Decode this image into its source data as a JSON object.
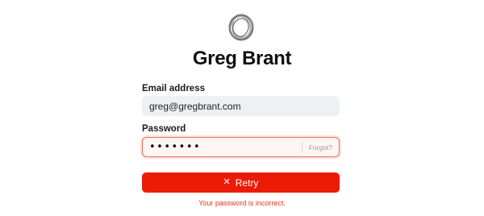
{
  "app": {
    "title": "Greg Brant",
    "logo_icon": "ring-logo-icon"
  },
  "email": {
    "label": "Email address",
    "value": "greg@gregbrant.com"
  },
  "password": {
    "label": "Password",
    "masked_value": "•••••••",
    "forgot_label": "Forgot?"
  },
  "actions": {
    "retry_label": "Retry",
    "retry_icon": "x-icon"
  },
  "error": {
    "message": "Your password is incorrect."
  },
  "colors": {
    "accent": "#ec1b05",
    "error_text": "#e2331d",
    "input_bg": "#eef1f3",
    "error_border": "#f1735f"
  }
}
